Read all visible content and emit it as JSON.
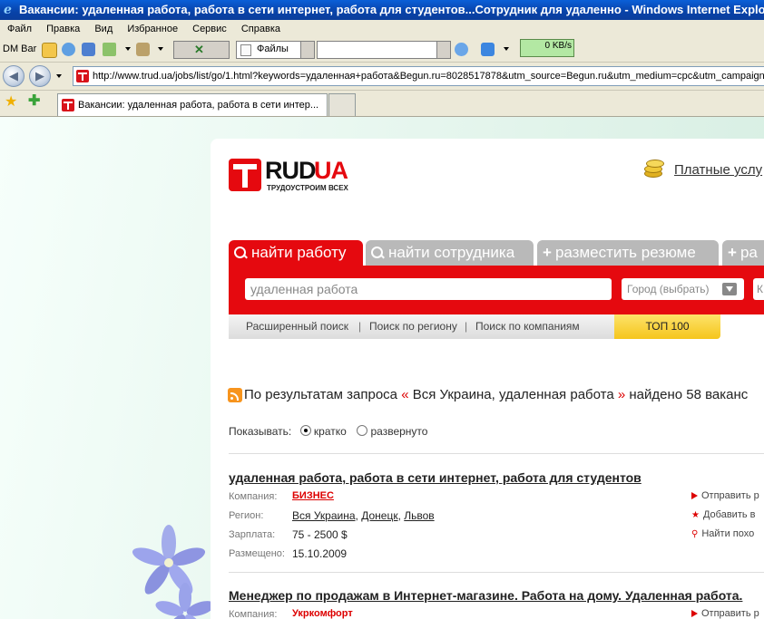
{
  "window": {
    "title": "Вакансии: удаленная работа, работа в сети интернет, работа для студентов...Сотрудник для удаленно - Windows Internet Explorer"
  },
  "menu": [
    "Файл",
    "Правка",
    "Вид",
    "Избранное",
    "Сервис",
    "Справка"
  ],
  "toolbar": {
    "dm_bar": "DM Bar",
    "files_label": "Файлы",
    "speed": "0 KB/s"
  },
  "address": {
    "url": "http://www.trud.ua/jobs/list/go/1.html?keywords=удаленная+работа&Begun.ru=8028517878&utm_source=Begun.ru&utm_medium=cpc&utm_campaign"
  },
  "tab": {
    "title": "Вакансии: удаленная работа, работа в сети интер..."
  },
  "site": {
    "logo_main": "RUD",
    "logo_ua": "UA",
    "logo_tagline": "ТРУДОУСТРОИМ ВСЕХ",
    "paid_services": "Платные услу",
    "search_tabs": [
      "найти работу",
      "найти сотрудника",
      "разместить резюме",
      "ра"
    ],
    "search_value": "удаленная работа",
    "city_placeholder": "Город (выбрать)",
    "extra_input": "К",
    "links": [
      "Расширенный поиск",
      "Поиск по региону",
      "Поиск по компаниям"
    ],
    "top100": "ТОП 100",
    "results_prefix": "По результатам запроса",
    "results_query": "Вся Украина, удаленная работа",
    "results_suffix": "найдено 58 ваканс",
    "show_label": "Показывать:",
    "show_brief": "кратко",
    "show_full": "развернуто"
  },
  "labels": {
    "company": "Компания:",
    "region": "Регион:",
    "salary": "Зарплата:",
    "posted": "Размещено:"
  },
  "jobs": [
    {
      "title": "удаленная работа, работа в сети интернет, работа для студентов",
      "company": "БИЗНЕС",
      "region": [
        "Вся Украина",
        "Донецк",
        "Львов"
      ],
      "salary": "75 - 2500 $",
      "posted": "15.10.2009",
      "actions": [
        "Отправить р",
        "Добавить в",
        "Найти похо"
      ]
    },
    {
      "title": "Менеджер по продажам в Интернет-магазине. Работа на дому. Удаленная работа.",
      "company": "Укркомфорт",
      "actions": [
        "Отправить р"
      ]
    }
  ],
  "colors": {
    "brand_red": "#e5090f",
    "link_red": "#d00000",
    "top100_yellow": "#fbd93a"
  }
}
